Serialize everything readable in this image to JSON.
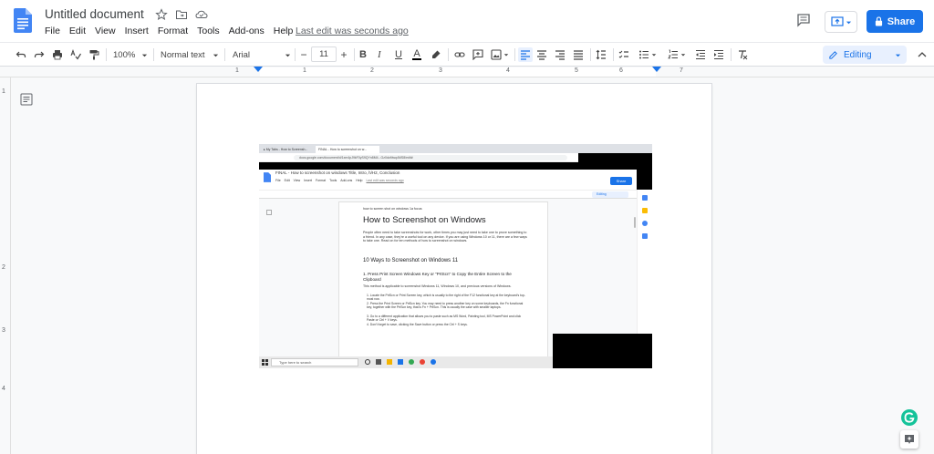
{
  "doc": {
    "title": "Untitled document",
    "menu": [
      "File",
      "Edit",
      "View",
      "Insert",
      "Format",
      "Tools",
      "Add-ons",
      "Help"
    ],
    "last_edit": "Last edit was seconds ago"
  },
  "header": {
    "share_label": "Share"
  },
  "toolbar": {
    "zoom": "100%",
    "style": "Normal text",
    "font": "Arial",
    "font_size": "11",
    "minus": "−",
    "plus": "+",
    "bold": "B",
    "italic": "I",
    "underline": "U",
    "text_color": "A",
    "mode": "Editing"
  },
  "ruler": {
    "marks": [
      "1",
      "1",
      "2",
      "3",
      "4",
      "5",
      "6",
      "7"
    ]
  },
  "left_ruler": {
    "marks": [
      "1",
      "2",
      "3",
      "4"
    ]
  },
  "screenshot": {
    "tabs": [
      "▸ My Tabs - How to Screensh...",
      "FINAL - How to screenshot on w..."
    ],
    "url": "docs.google.com/document/d/1xm4pJ9kF0yS9QYn8M4...Gz0dzMwq4MS8/edit#",
    "doc_title": "FINAL - How to screenshot on windows Title, Intro, h/H2, Conclusion",
    "menu": [
      "File",
      "Edit",
      "View",
      "Insert",
      "Format",
      "Tools",
      "Add-ons",
      "Help"
    ],
    "last_edit": "Last edit was seconds ago",
    "share": "Share",
    "editing": "Editing",
    "keyword": "how to screen shot on windows 1a focus",
    "heading": "How to Screenshot on Windows",
    "intro": "People often need to take screenshots for work, other times you may just need to take one to prove something to a friend. In any case, they're a useful tool on any device. If you are using Windows 10 or 11, there are a few ways to take one. Read on for ten methods of how to screenshot on windows.",
    "subheading": "10 Ways to Screenshot on Windows 11",
    "step_title": "1.   Press Print Screen Windows Key or \"PrtScn\" to Copy the Entire Screen to the Clipboard",
    "step_note": "This method is applicable to screenshot Windows 11, Windows 10, and previous versions of Windows.",
    "bullets": [
      "1.   Locate the PrtScn or Print Screen key, which is usually to the right of the F12 functional key at the keyboard's top-most row.",
      "2.   Press the Print Screen or PrtScn key. You may need to press another key on some keyboards, the Fn functional key, together with the PrtScn key, that is Fn + PrtScn. This is usually the case with smaller laptops.",
      "3.   Go to a different application that allows you to paste such as MS Word, Painting tool, MS PowerPoint and click Paste or Ctrl + V keys.",
      "4.   Don't forget to save, clicking the Save button or press the Ctrl + S keys."
    ],
    "taskbar_search": "Type here to search"
  },
  "colors": {
    "accent": "#1a73e8",
    "grammarly": "#15c39a",
    "docs_blue": "#4285f4"
  }
}
